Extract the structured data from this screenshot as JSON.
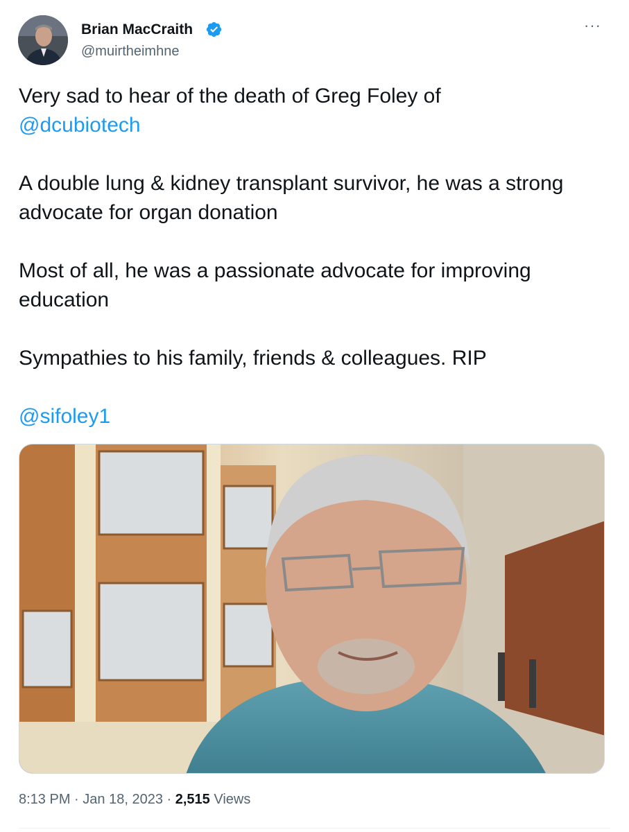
{
  "author": {
    "name": "Brian MacCraith",
    "handle": "@muirtheimhne",
    "verified": true,
    "avatar_icon": "avatar-photo"
  },
  "more_icon": "more-dots-icon",
  "more_label": "···",
  "tweet": {
    "line1": "Very sad to hear of the death of Greg Foley of",
    "mention1": "@dcubiotech",
    "para2": "A double lung & kidney transplant survivor, he was a strong advocate for organ donation",
    "para3": "Most of all, he was a passionate advocate for improving education",
    "para4": "Sympathies to his family, friends & colleagues. RIP",
    "mention2": "@sifoley1"
  },
  "media": {
    "type": "photo"
  },
  "meta": {
    "time": "8:13 PM",
    "date": "Jan 18, 2023",
    "views_count": "2,515",
    "views_label": "Views",
    "separator": "·"
  },
  "colors": {
    "link": "#1d9bf0",
    "secondary_text": "#536471",
    "primary_text": "#0f1419"
  }
}
